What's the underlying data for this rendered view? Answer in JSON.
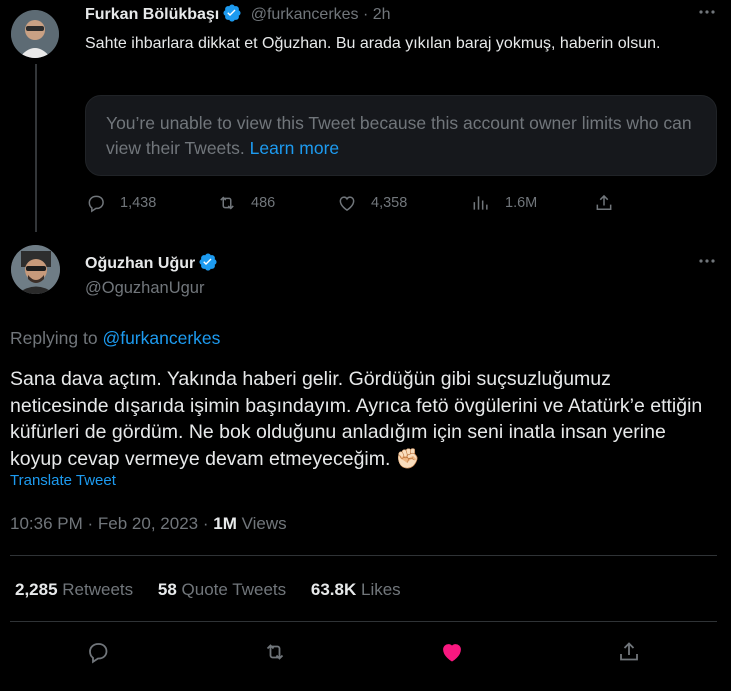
{
  "reply_tweet": {
    "author_name": "Furkan Bölükbaşı",
    "handle": "@furkancerkes",
    "separator": "·",
    "time": "2h",
    "text": "Sahte ihbarlara dikkat et Oğuzhan. Bu arada yıkılan baraj yokmuş, haberin olsun.",
    "quoted_notice": "You’re unable to view this Tweet because this account owner limits who can view their Tweets.",
    "quoted_notice_link": "Learn more",
    "stats": {
      "replies": "1,438",
      "retweets": "486",
      "likes": "4,358",
      "views": "1.6M"
    }
  },
  "main_tweet": {
    "author_name": "Oğuzhan Uğur",
    "handle": "@OguzhanUgur",
    "replying_to_label": "Replying to",
    "replying_to_handle": "@furkancerkes",
    "text": "Sana dava açtım. Yakında haberi gelir. Gördüğün gibi suçsuzluğumuz neticesinde dışarıda işimin başındayım. Ayrıca fetö övgülerini ve Atatürk’e ettiğin küfürleri de gördüm. Ne bok olduğunu anladığım için seni inatla insan yerine koyup cevap vermeye devam etmeyeceğim.",
    "emoji": "✊🏻",
    "translate_label": "Translate Tweet",
    "time": "10:36 PM",
    "date_separator": "·",
    "date": "Feb 20, 2023",
    "views_separator": "·",
    "views_count": "1M",
    "views_label": "Views",
    "stats": {
      "retweets_count": "2,285",
      "retweets_label": "Retweets",
      "quote_count": "58",
      "quote_label": "Quote Tweets",
      "likes_count": "63.8K",
      "likes_label": "Likes"
    },
    "liked": true
  },
  "icons": {
    "more": "more-horizontal-icon",
    "verified": "verified-badge-icon",
    "reply": "reply-icon",
    "retweet": "retweet-icon",
    "like": "heart-icon",
    "views": "views-chart-icon",
    "share": "share-icon"
  },
  "colors": {
    "background": "#000000",
    "text": "#e7e9ea",
    "muted": "#71767b",
    "link": "#1d9bf0",
    "verified": "#1d9bf0",
    "liked": "#f91880",
    "divider": "#2f3336"
  }
}
